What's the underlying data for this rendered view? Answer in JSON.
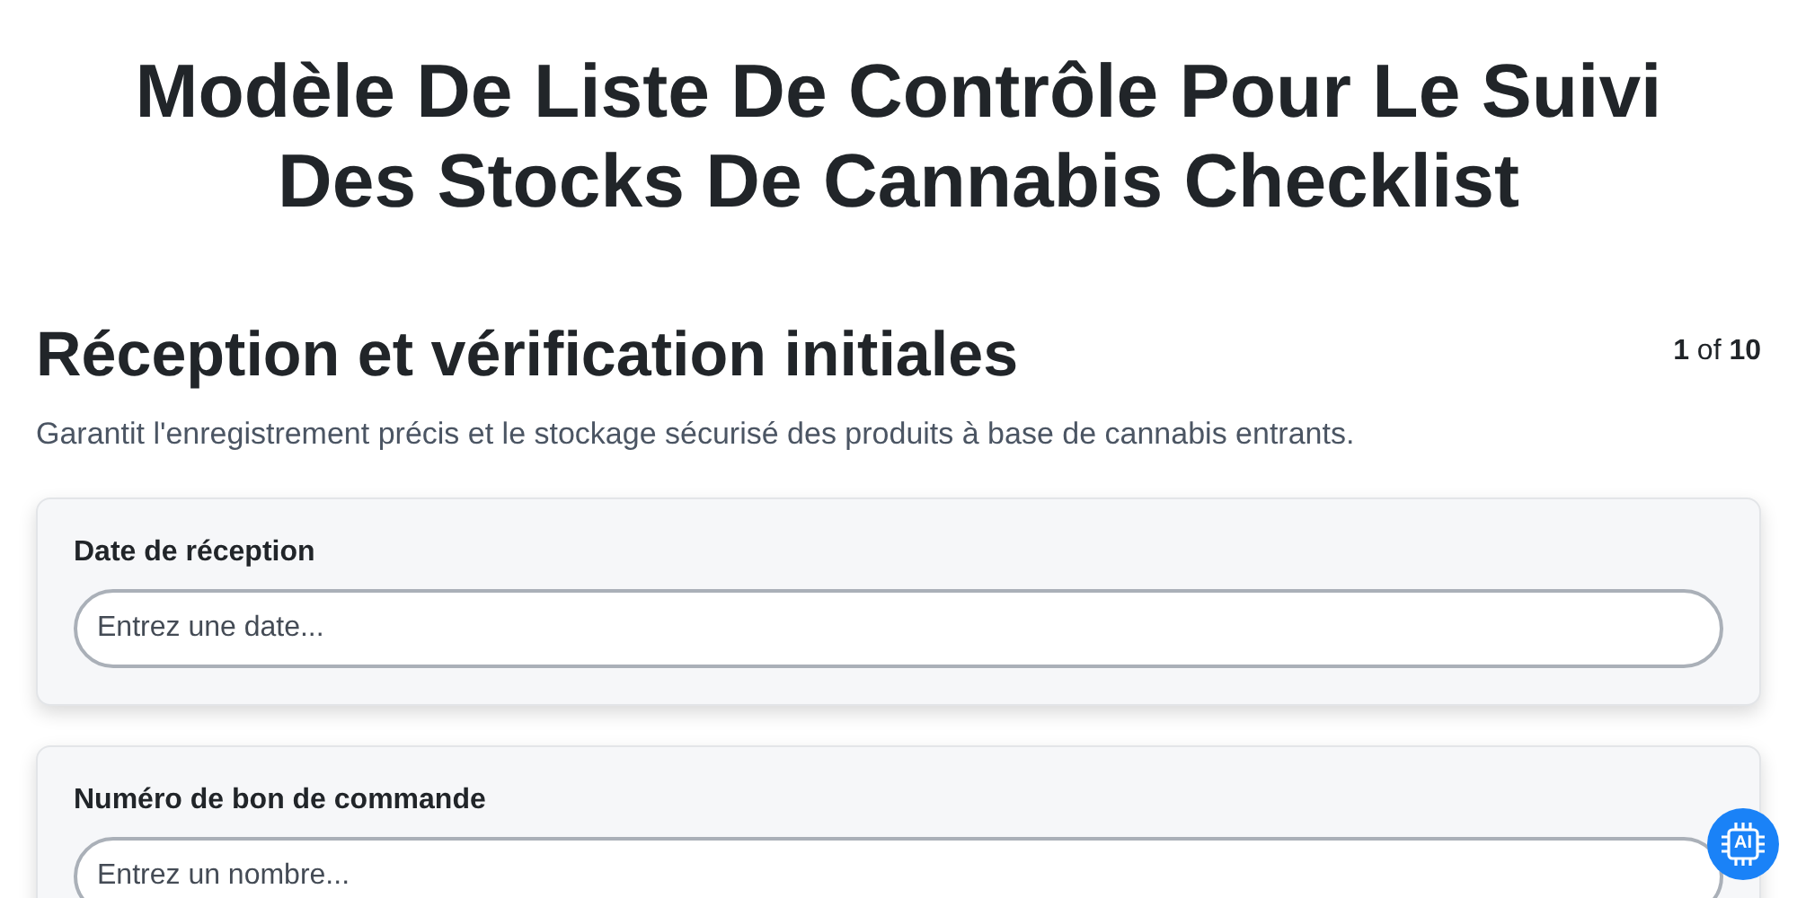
{
  "title": "Modèle De Liste De Contrôle Pour Le Suivi Des Stocks De Cannabis Checklist",
  "section": {
    "heading": "Réception et vérification initiales",
    "counter": "**1** of **10**",
    "description": "Garantit l'enregistrement précis et le stockage sécurisé des produits à base de cannabis entrants."
  },
  "fields": [
    {
      "label": "Date de réception",
      "placeholder": "Entrez une date..."
    },
    {
      "label": "Numéro de bon de commande",
      "placeholder": "Entrez un nombre..."
    }
  ],
  "ai_button": {
    "label": "AI"
  }
}
